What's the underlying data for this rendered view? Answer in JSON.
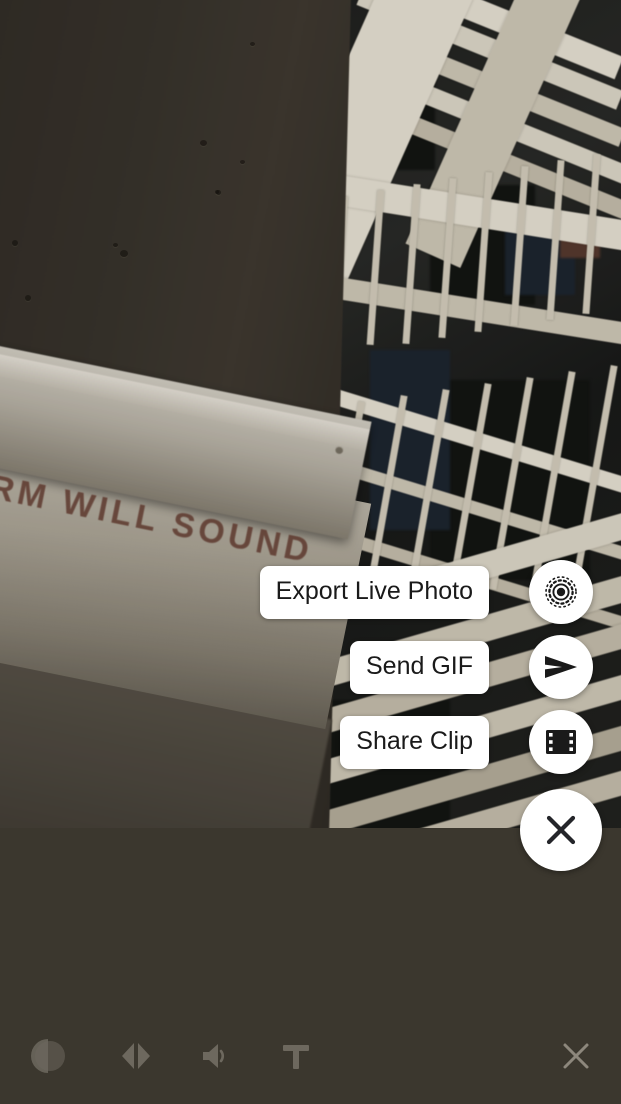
{
  "app": {
    "background_color": "#3b372e",
    "photo": {
      "description": "Fire escape staircase seen from above with dark wall at left and an emergency exit door",
      "sign_text": "ARM WILL SOUND",
      "stair_color": "#e8e2d2",
      "wall_color": "#3b362e"
    }
  },
  "action_menu": {
    "items": [
      {
        "label": "Export Live Photo",
        "icon": "live-photo-icon",
        "name": "export-live-photo"
      },
      {
        "label": "Send GIF",
        "icon": "send-icon",
        "name": "send-gif"
      },
      {
        "label": "Share Clip",
        "icon": "film-strip-icon",
        "name": "share-clip"
      }
    ],
    "close": {
      "label": "",
      "icon": "close-icon",
      "name": "close-action-menu"
    }
  },
  "toolbar": {
    "icon_color": "#6d685e",
    "tools": [
      {
        "name": "filter-adjust",
        "icon": "filter-icon",
        "label": "Filter"
      },
      {
        "name": "mirror-flip",
        "icon": "mirror-icon",
        "label": "Mirror"
      },
      {
        "name": "volume",
        "icon": "volume-icon",
        "label": "Volume"
      },
      {
        "name": "text",
        "icon": "text-icon",
        "label": "Text"
      }
    ],
    "close": {
      "name": "close-editor",
      "icon": "close-icon",
      "label": "Close"
    }
  }
}
